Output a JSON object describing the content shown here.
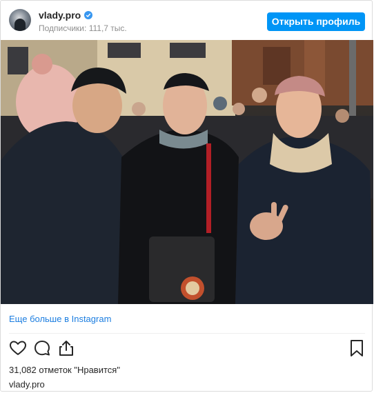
{
  "header": {
    "username": "vlady.pro",
    "followers_label": "Подписчики:",
    "followers_count": "111,7 тыс.",
    "open_profile_label": "Открыть профиль"
  },
  "post": {
    "more_link": "Еще больше в Instagram",
    "likes": "31,082 отметок \"Нравится\"",
    "owner": "vlady.pro",
    "image_content": "Three young men posing at night on a crowded city street",
    "icons": [
      "heart-icon",
      "comment-icon",
      "share-icon",
      "bookmark-icon",
      "verified-badge-icon"
    ]
  },
  "colors": {
    "button": "#0095f6",
    "link": "#1b7de0",
    "text": "#262626",
    "muted": "#8e8e8e",
    "border": "#dbdbdb",
    "verified": "#3897f0"
  }
}
